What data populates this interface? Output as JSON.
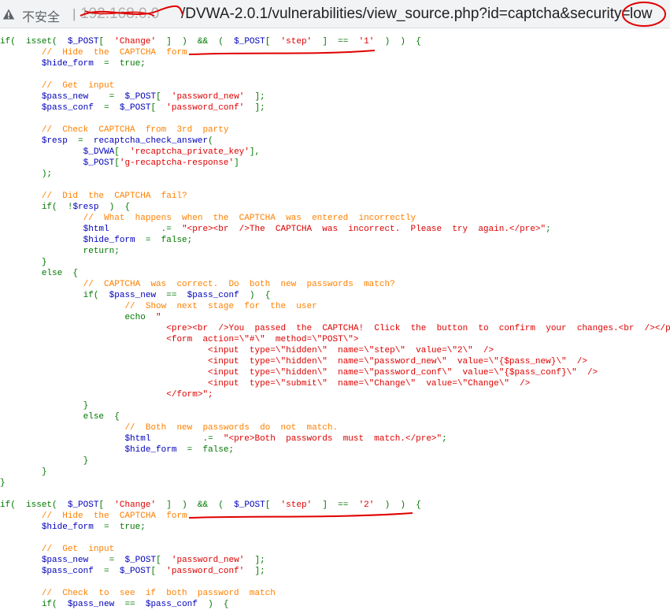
{
  "browser": {
    "insecure_label": "不安全",
    "separator": "|",
    "url_host": "192.168.0.0",
    "url_path": "/DVWA-2.0.1/vulnerabilities/view_source.php?id=captcha&security=",
    "url_level": "low",
    "annotation_color": "#e00000"
  },
  "source": {
    "lines": [
      "if(  isset(  $_POST[  'Change'  ]  )  &&  (  $_POST[  'step'  ]  ==  '1'  )  )  {",
      "        //  Hide  the  CAPTCHA  form",
      "        $hide_form  =  true;",
      "",
      "        //  Get  input",
      "        $pass_new    =  $_POST[  'password_new'  ];",
      "        $pass_conf  =  $_POST[  'password_conf'  ];",
      "",
      "        //  Check  CAPTCHA  from  3rd  party",
      "        $resp  =  recaptcha_check_answer(",
      "                $_DVWA[  'recaptcha_private_key'],",
      "                $_POST['g-recaptcha-response']",
      "        );",
      "",
      "        //  Did  the  CAPTCHA  fail?",
      "        if(  !$resp  )  {",
      "                //  What  happens  when  the  CAPTCHA  was  entered  incorrectly",
      "                $html          .=  \"<pre><br  />The  CAPTCHA  was  incorrect.  Please  try  again.</pre>\";",
      "                $hide_form  =  false;",
      "                return;",
      "        }",
      "        else  {",
      "                //  CAPTCHA  was  correct.  Do  both  new  passwords  match?",
      "                if(  $pass_new  ==  $pass_conf  )  {",
      "                        //  Show  next  stage  for  the  user",
      "                        echo  \"",
      "                                <pre><br  />You  passed  the  CAPTCHA!  Click  the  button  to  confirm  your  changes.<br  /></pre>",
      "                                <form  action=\\\"#\\\"  method=\\\"POST\\\">",
      "                                        <input  type=\\\"hidden\\\"  name=\\\"step\\\"  value=\\\"2\\\"  />",
      "                                        <input  type=\\\"hidden\\\"  name=\\\"password_new\\\"  value=\\\"{$pass_new}\\\"  />",
      "                                        <input  type=\\\"hidden\\\"  name=\\\"password_conf\\\"  value=\\\"{$pass_conf}\\\"  />",
      "                                        <input  type=\\\"submit\\\"  name=\\\"Change\\\"  value=\\\"Change\\\"  />",
      "                                </form>\";",
      "                }",
      "                else  {",
      "                        //  Both  new  passwords  do  not  match.",
      "                        $html          .=  \"<pre>Both  passwords  must  match.</pre>\";",
      "                        $hide_form  =  false;",
      "                }",
      "        }",
      "}",
      "",
      "if(  isset(  $_POST[  'Change'  ]  )  &&  (  $_POST[  'step'  ]  ==  '2'  )  )  {",
      "        //  Hide  the  CAPTCHA  form",
      "        $hide_form  =  true;",
      "",
      "        //  Get  input",
      "        $pass_new    =  $_POST[  'password_new'  ];",
      "        $pass_conf  =  $_POST[  'password_conf'  ];",
      "",
      "        //  Check  to  see  if  both  password  match",
      "        if(  $pass_new  ==  $pass_conf  )  {"
    ]
  }
}
